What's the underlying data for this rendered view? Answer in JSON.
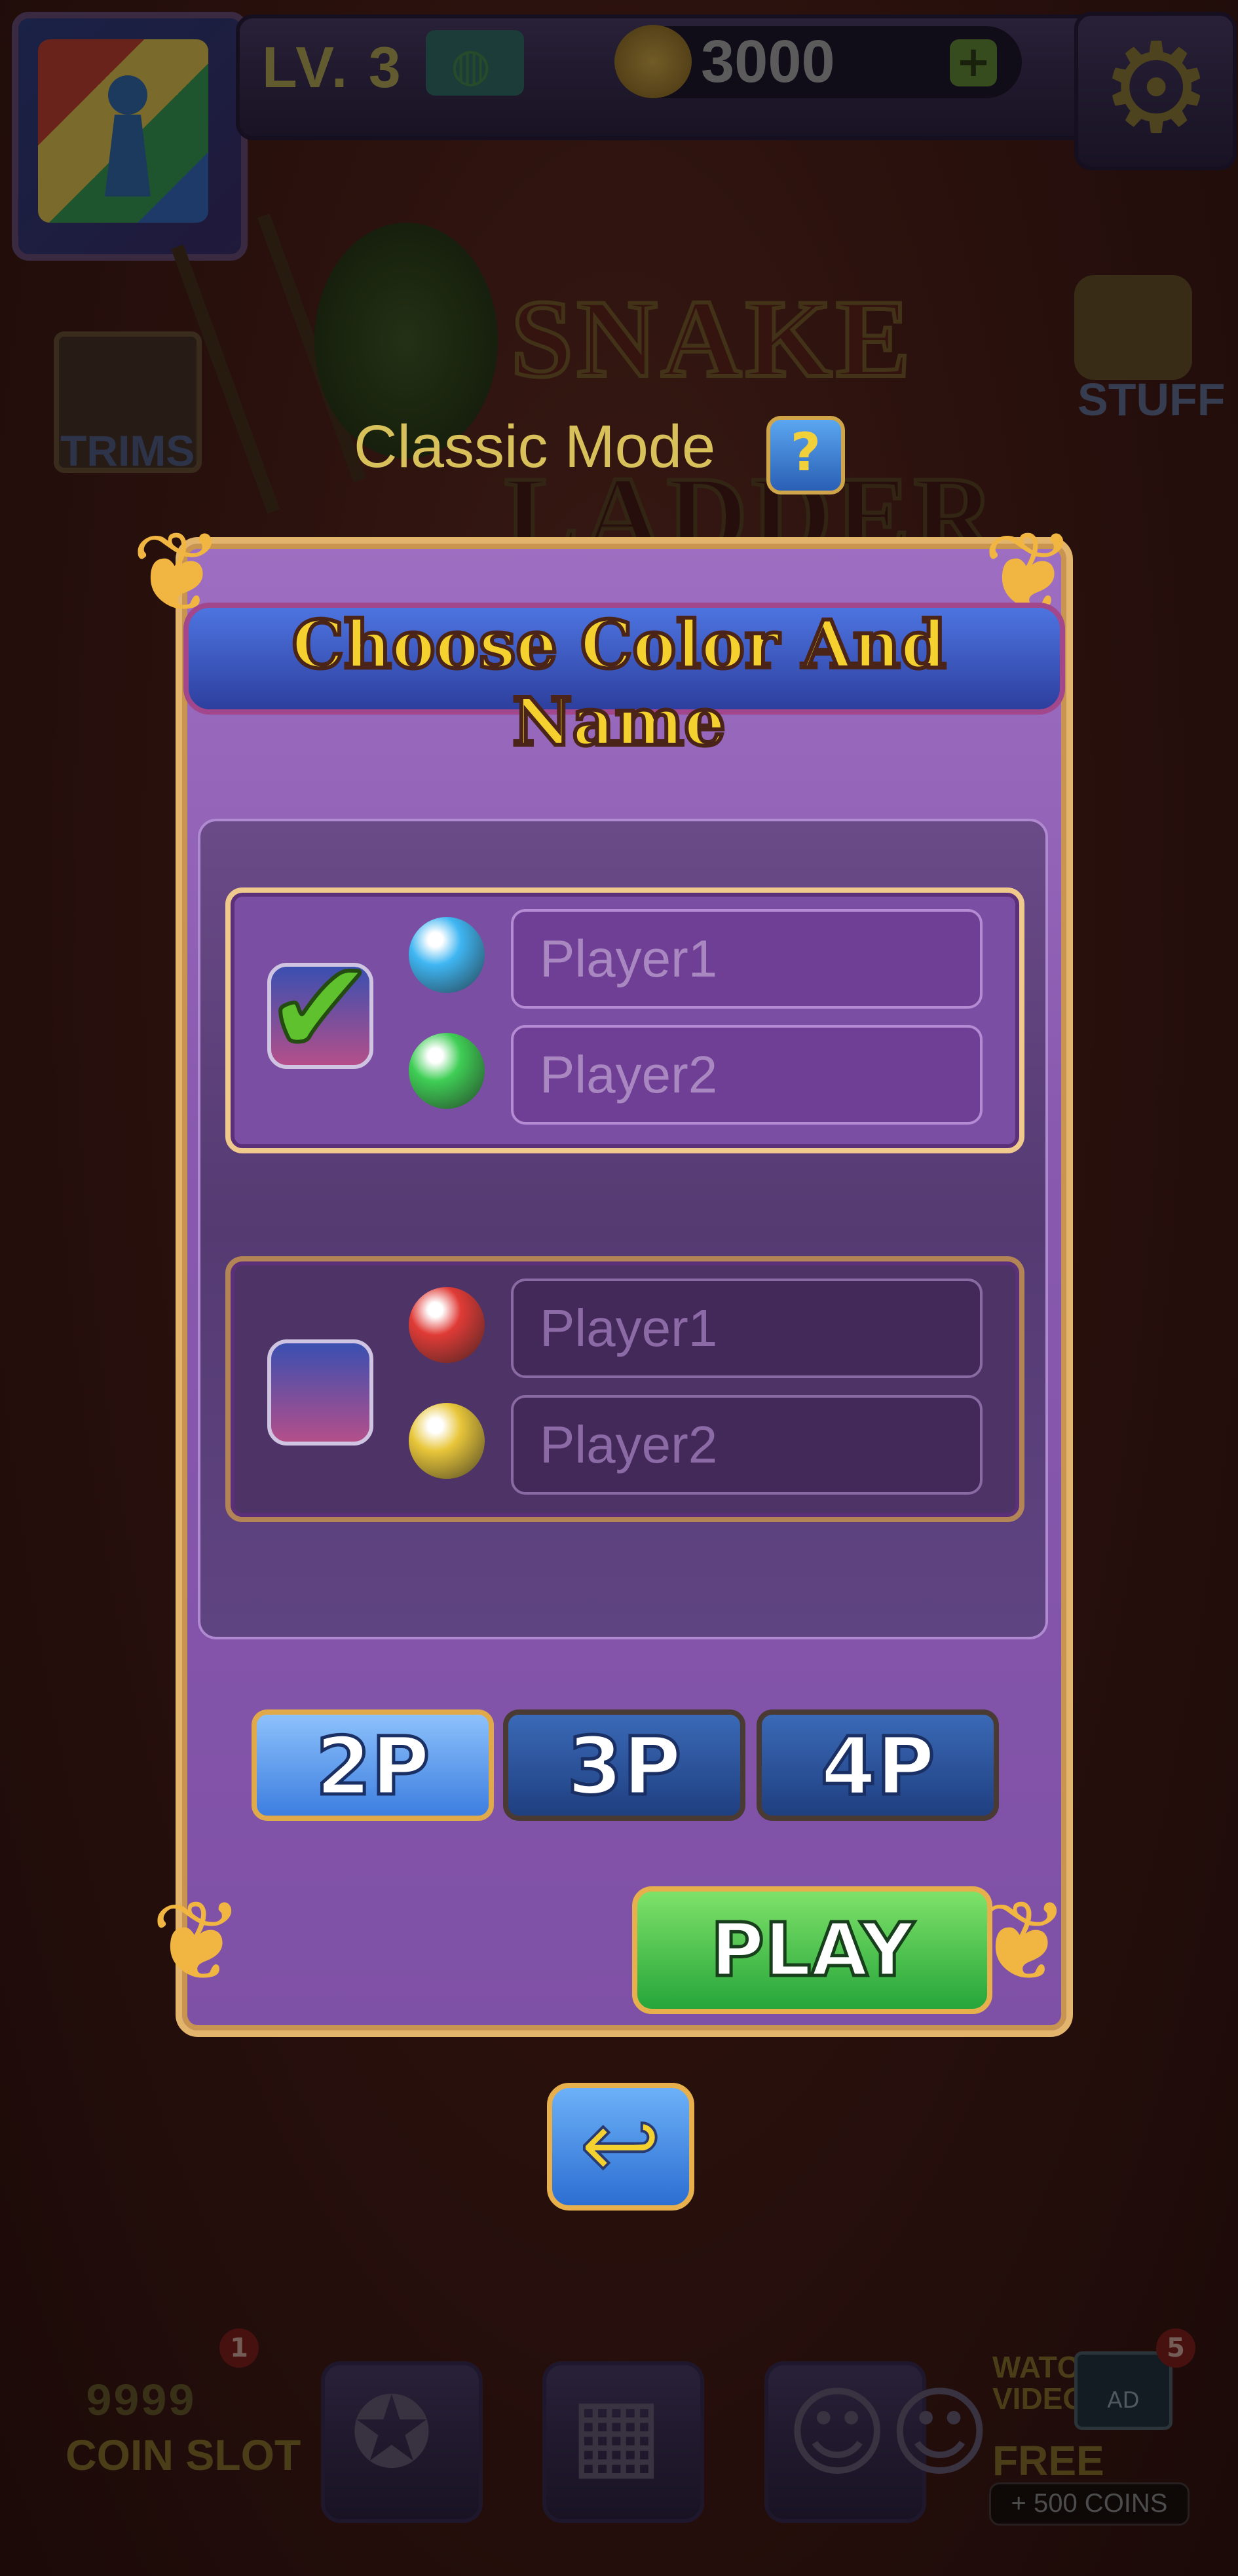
{
  "top_bar": {
    "level_text": "LV. 3",
    "coins": "3000",
    "add_coins": "+"
  },
  "side": {
    "trims_label": "TRIMS",
    "stuff_label": "STUFF"
  },
  "logo": {
    "line1": "SNAKE",
    "line2": "LADDER"
  },
  "mode": {
    "title": "Classic Mode",
    "help": "?"
  },
  "dialog": {
    "title": "Choose Color And Name",
    "groups": [
      {
        "checked": true,
        "players": [
          {
            "name": "Player1",
            "color": "#3fb6f2"
          },
          {
            "name": "Player2",
            "color": "#3fce55"
          }
        ]
      },
      {
        "checked": false,
        "players": [
          {
            "name": "Player1",
            "color": "#e03b36"
          },
          {
            "name": "Player2",
            "color": "#e8c63a"
          }
        ]
      }
    ],
    "player_count_buttons": [
      "2P",
      "3P",
      "4P"
    ],
    "selected_player_count": "2P",
    "play_label": "PLAY",
    "back_icon": "undo-arrow-icon"
  },
  "bottom_bar": {
    "coin_slot_label": "COIN SLOT",
    "coin_slot_digits": "9999",
    "coin_slot_badge": "1",
    "watch_video_label": "WATCH VIDEO",
    "ad_label": "AD",
    "free_coins_label": "FREE COINS",
    "free_coins_badge": "5",
    "free_coins_amount": "+ 500 COINS"
  },
  "colors": {
    "dialog_purple": "#8859ae",
    "gold_border": "#e3b46b",
    "title_yellow": "#f4d12f",
    "play_green": "#26a53a",
    "button_blue": "#3d7ee0"
  }
}
